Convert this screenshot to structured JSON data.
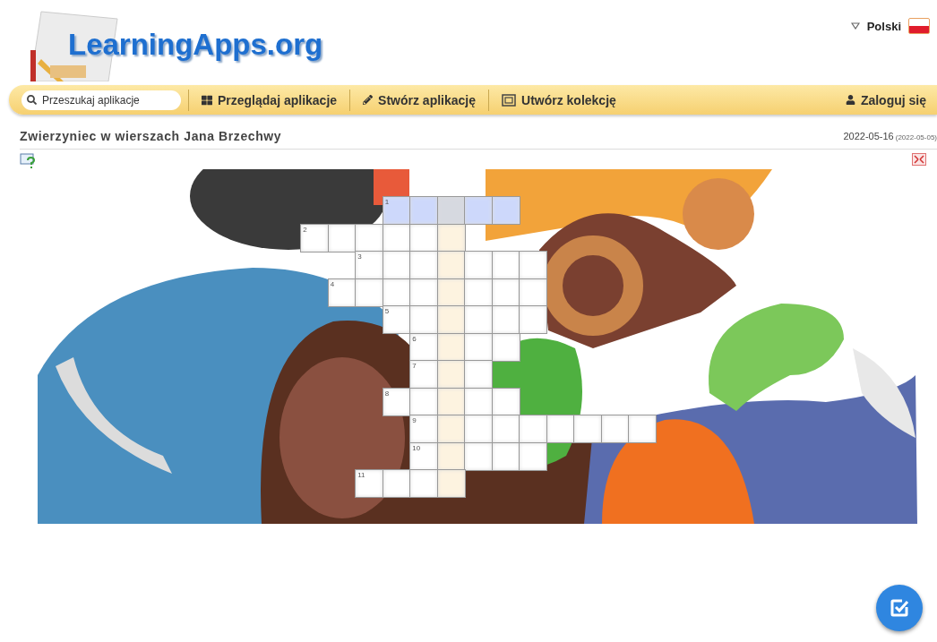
{
  "header": {
    "logo": "LearningApps.org",
    "language": "Polski"
  },
  "nav": {
    "search_placeholder": "Przeszukaj aplikacje",
    "items": [
      {
        "kind": "browse",
        "label": "Przeglądaj aplikacje"
      },
      {
        "kind": "create",
        "label": "Stwórz aplikację"
      },
      {
        "kind": "collection",
        "label": "Utwórz kolekcję"
      }
    ],
    "login": "Zaloguj się"
  },
  "app": {
    "title": "Zwierzyniec w wierszach Jana Brzechwy",
    "date": "2022-05-16",
    "created": "(2022-05-05)"
  },
  "crossword": {
    "words": [
      {
        "number": "1",
        "selected": true
      },
      {
        "number": "2",
        "selected": false
      },
      {
        "number": "3",
        "selected": false
      },
      {
        "number": "4",
        "selected": false
      },
      {
        "number": "5",
        "selected": false
      },
      {
        "number": "6",
        "selected": false
      },
      {
        "number": "7",
        "selected": false
      },
      {
        "number": "8",
        "selected": false
      },
      {
        "number": "9",
        "selected": false
      },
      {
        "number": "10",
        "selected": false
      },
      {
        "number": "11",
        "selected": false
      }
    ]
  }
}
